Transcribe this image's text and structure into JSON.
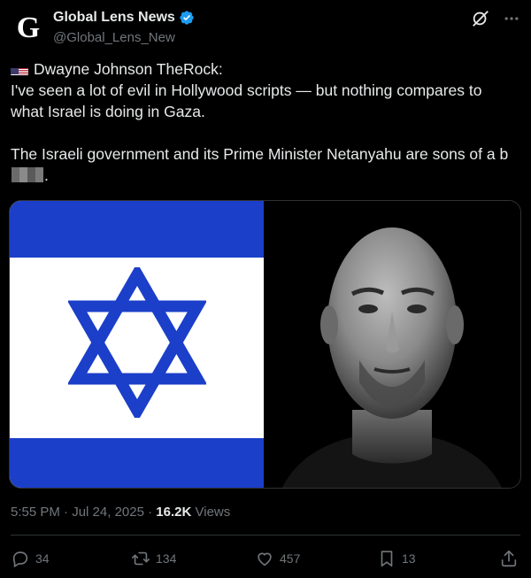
{
  "header": {
    "avatar_glyph": "G",
    "name": "Global Lens News",
    "handle": "@Global_Lens_New"
  },
  "tweet": {
    "line1": "Dwayne Johnson TheRock:",
    "line2": "I've seen a lot of evil in Hollywood scripts — but nothing compares to what Israel is doing in Gaza.",
    "line3_start": "The Israeli government and its Prime Minister Netanyahu are sons of a b",
    "line3_end": "."
  },
  "meta": {
    "time": "5:55 PM",
    "date": "Jul 24, 2025",
    "views_count": "16.2K",
    "views_label": "Views",
    "separator": "·"
  },
  "actions": {
    "replies": "34",
    "reposts": "134",
    "likes": "457",
    "bookmarks": "13"
  },
  "colors": {
    "background": "#000000",
    "text": "#e7e9ea",
    "muted": "#71767b",
    "verified": "#1d9bf0",
    "flag_blue": "#1b3fc9"
  }
}
